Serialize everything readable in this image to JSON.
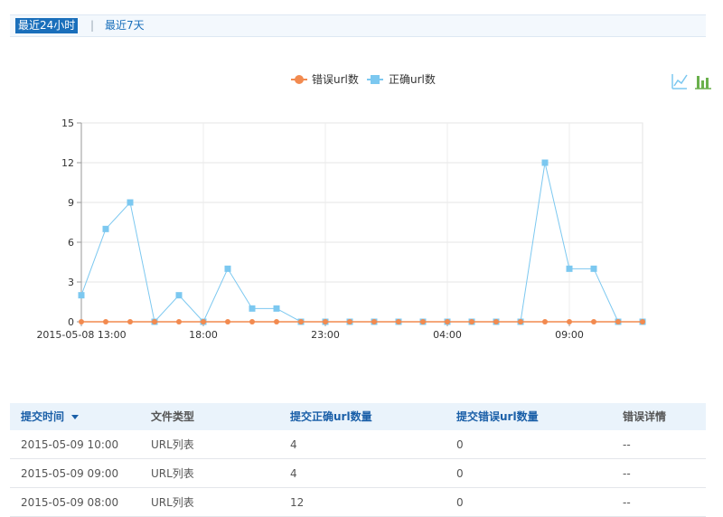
{
  "tabs": {
    "active": "最近24小时",
    "separator": "|",
    "other": "最近7天"
  },
  "toolbar": {
    "line_icon": "line-chart-icon",
    "bar_icon": "bar-chart-icon",
    "accent": "#7cc8f0",
    "bar_color": "#6ab04c"
  },
  "chart_data": {
    "type": "line",
    "legend": [
      "错误url数",
      "正确url数"
    ],
    "x": [
      "2015-05-08 13:00",
      "14:00",
      "15:00",
      "16:00",
      "17:00",
      "18:00",
      "19:00",
      "20:00",
      "21:00",
      "22:00",
      "23:00",
      "00:00",
      "01:00",
      "02:00",
      "03:00",
      "04:00",
      "05:00",
      "06:00",
      "07:00",
      "08:00",
      "09:00",
      "10:00",
      "11:00",
      "12:00"
    ],
    "x_tick_labels": [
      "2015-05-08 13:00",
      "18:00",
      "23:00",
      "04:00",
      "09:00"
    ],
    "y_tick_labels": [
      "0",
      "3",
      "6",
      "9",
      "12",
      "15"
    ],
    "ylim": [
      0,
      15
    ],
    "series": [
      {
        "name": "错误url数",
        "color": "#f28a4f",
        "marker": "circle",
        "values": [
          0,
          0,
          0,
          0,
          0,
          0,
          0,
          0,
          0,
          0,
          0,
          0,
          0,
          0,
          0,
          0,
          0,
          0,
          0,
          0,
          0,
          0,
          0,
          0
        ]
      },
      {
        "name": "正确url数",
        "color": "#7cc8f0",
        "marker": "square",
        "values": [
          2,
          7,
          9,
          0,
          2,
          0,
          4,
          1,
          1,
          0,
          0,
          0,
          0,
          0,
          0,
          0,
          0,
          0,
          0,
          12,
          4,
          4,
          0,
          0
        ]
      }
    ],
    "grid": true,
    "legend_position": "top-center"
  },
  "table": {
    "headers": [
      "提交时间",
      "文件类型",
      "提交正确url数量",
      "提交错误url数量",
      "错误详情"
    ],
    "rows": [
      [
        "2015-05-09 10:00",
        "URL列表",
        "4",
        "0",
        "--"
      ],
      [
        "2015-05-09 09:00",
        "URL列表",
        "4",
        "0",
        "--"
      ],
      [
        "2015-05-09 08:00",
        "URL列表",
        "12",
        "0",
        "--"
      ]
    ]
  }
}
